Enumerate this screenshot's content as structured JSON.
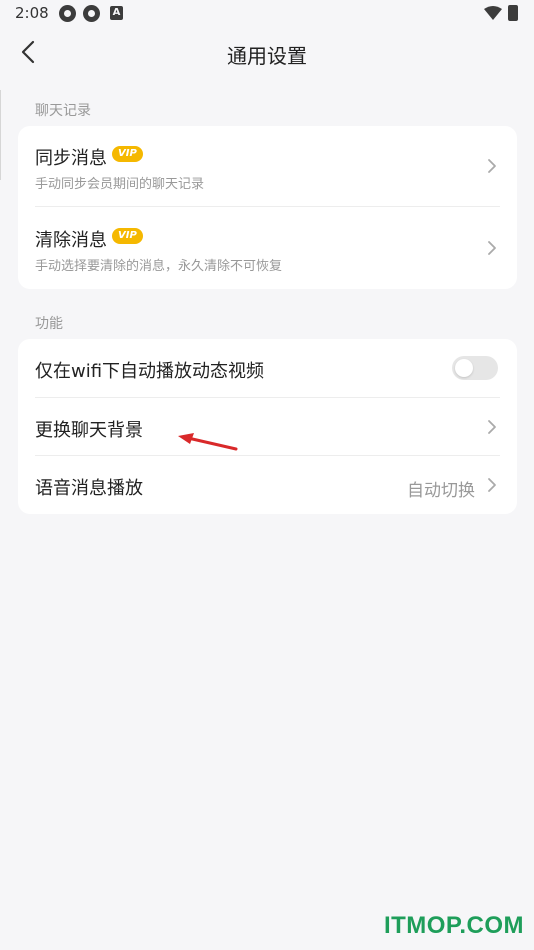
{
  "status_bar": {
    "time": "2:08",
    "a_badge": "A"
  },
  "header": {
    "title": "通用设置"
  },
  "section_chat": {
    "label": "聊天记录",
    "items": [
      {
        "title": "同步消息",
        "badge": "VIP",
        "subtitle": "手动同步会员期间的聊天记录"
      },
      {
        "title": "清除消息",
        "badge": "VIP",
        "subtitle": "手动选择要清除的消息，永久清除不可恢复"
      }
    ]
  },
  "section_function": {
    "label": "功能",
    "items": [
      {
        "title": "仅在wifi下自动播放动态视频",
        "toggle_on": false
      },
      {
        "title": "更换聊天背景"
      },
      {
        "title": "语音消息播放",
        "value": "自动切换"
      }
    ]
  },
  "watermark": "ITMOP.COM",
  "colors": {
    "vip": "#f5b800",
    "annotation_arrow": "#d9292a",
    "watermark": "#1e9e5a"
  }
}
